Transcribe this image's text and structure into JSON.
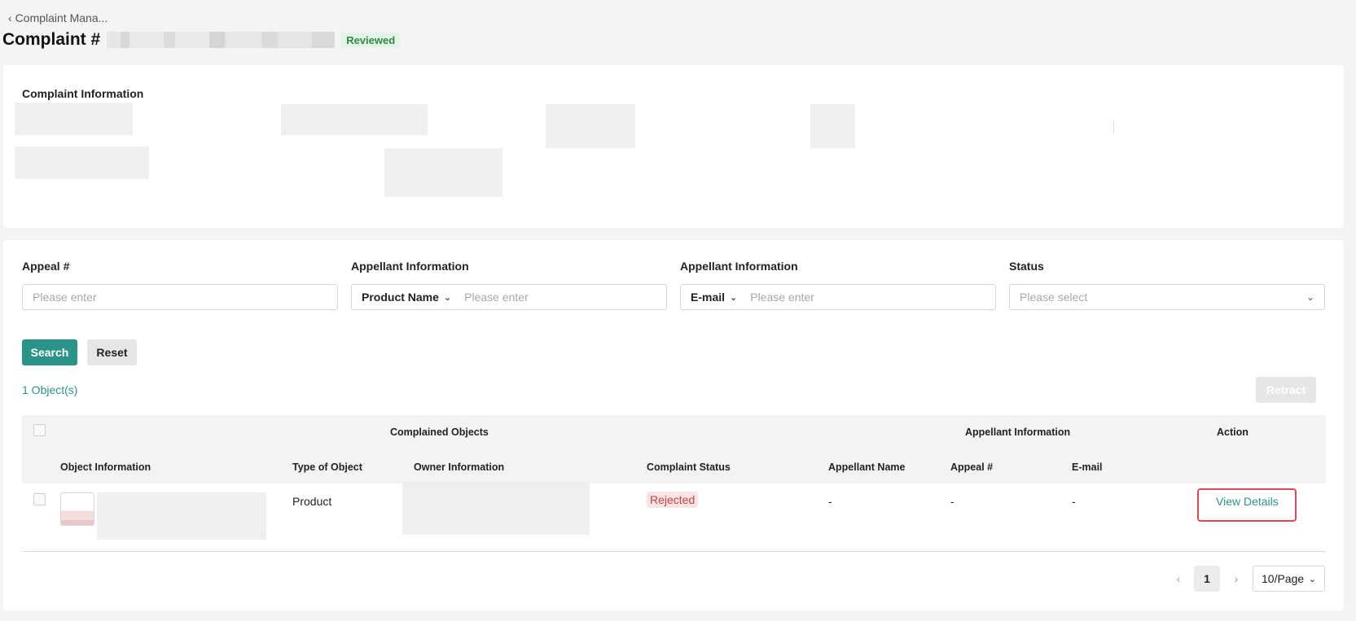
{
  "breadcrumb": {
    "back_label": "Complaint Mana..."
  },
  "header": {
    "title": "Complaint #",
    "status_badge": "Reviewed"
  },
  "info": {
    "section_title": "Complaint Information"
  },
  "filters": {
    "appeal_label": "Appeal #",
    "appeal_placeholder": "Please enter",
    "appellant1_label": "Appellant Information",
    "appellant1_select": "Product Name",
    "appellant1_placeholder": "Please enter",
    "appellant2_label": "Appellant Information",
    "appellant2_select": "E-mail",
    "appellant2_placeholder": "Please enter",
    "status_label": "Status",
    "status_placeholder": "Please select"
  },
  "actions": {
    "search": "Search",
    "reset": "Reset",
    "retract": "Retract"
  },
  "result_count": "1 Object(s)",
  "table": {
    "group_headers": {
      "complained": "Complained Objects",
      "appellant": "Appellant Information",
      "action": "Action"
    },
    "columns": [
      "Object Information",
      "Type of Object",
      "Owner Information",
      "Complaint Status",
      "Appellant Name",
      "Appeal #",
      "E-mail"
    ],
    "rows": [
      {
        "type": "Product",
        "status": "Rejected",
        "appellant_name": "-",
        "appeal_no": "-",
        "email": "-",
        "action": "View Details"
      }
    ]
  },
  "pagination": {
    "current": "1",
    "page_size": "10/Page"
  },
  "colors": {
    "accent": "#2b9488",
    "danger": "#e5474f",
    "reviewed": "#2e8b45"
  }
}
